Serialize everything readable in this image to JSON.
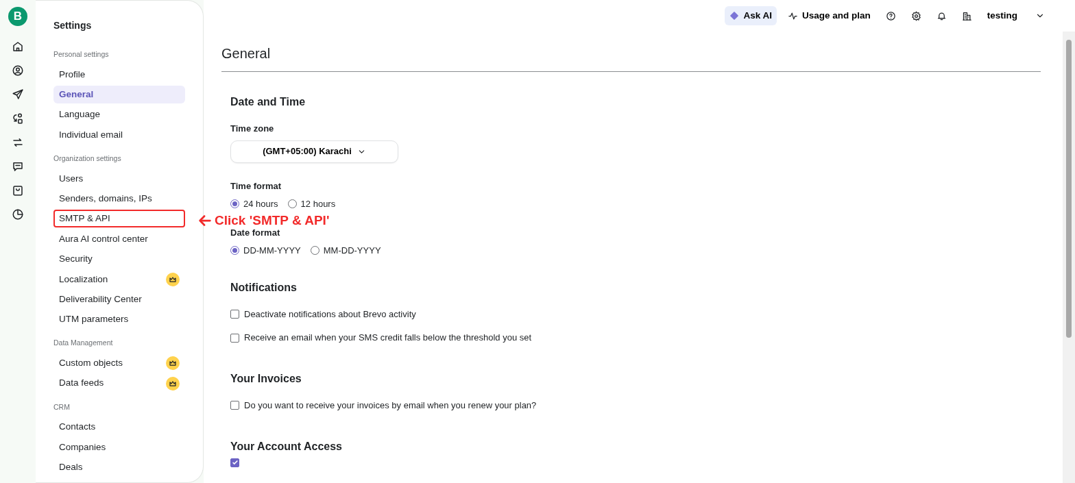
{
  "rail": {
    "logo": "B"
  },
  "sidebar": {
    "title": "Settings",
    "groups": [
      {
        "heading": "Personal settings",
        "items": [
          {
            "label": "Profile",
            "selected": false,
            "premium": false,
            "annotated": false
          },
          {
            "label": "General",
            "selected": true,
            "premium": false,
            "annotated": false
          },
          {
            "label": "Language",
            "selected": false,
            "premium": false,
            "annotated": false
          },
          {
            "label": "Individual email",
            "selected": false,
            "premium": false,
            "annotated": false
          }
        ]
      },
      {
        "heading": "Organization settings",
        "items": [
          {
            "label": "Users",
            "selected": false,
            "premium": false,
            "annotated": false
          },
          {
            "label": "Senders, domains, IPs",
            "selected": false,
            "premium": false,
            "annotated": false
          },
          {
            "label": "SMTP & API",
            "selected": false,
            "premium": false,
            "annotated": true
          },
          {
            "label": "Aura AI control center",
            "selected": false,
            "premium": false,
            "annotated": false
          },
          {
            "label": "Security",
            "selected": false,
            "premium": false,
            "annotated": false
          },
          {
            "label": "Localization",
            "selected": false,
            "premium": true,
            "annotated": false
          },
          {
            "label": "Deliverability Center",
            "selected": false,
            "premium": false,
            "annotated": false
          },
          {
            "label": "UTM parameters",
            "selected": false,
            "premium": false,
            "annotated": false
          }
        ]
      },
      {
        "heading": "Data Management",
        "items": [
          {
            "label": "Custom objects",
            "selected": false,
            "premium": true,
            "annotated": false
          },
          {
            "label": "Data feeds",
            "selected": false,
            "premium": true,
            "annotated": false
          }
        ]
      },
      {
        "heading": "CRM",
        "items": [
          {
            "label": "Contacts",
            "selected": false,
            "premium": false,
            "annotated": false
          },
          {
            "label": "Companies",
            "selected": false,
            "premium": false,
            "annotated": false
          },
          {
            "label": "Deals",
            "selected": false,
            "premium": false,
            "annotated": false
          }
        ]
      }
    ]
  },
  "annotation": {
    "text": "Click 'SMTP & API'"
  },
  "topbar": {
    "ask_ai": "Ask AI",
    "usage": "Usage and plan",
    "account": "testing"
  },
  "page_title": "General",
  "sections": [
    {
      "heading": "Date and Time",
      "fields": [
        {
          "kind": "select",
          "label": "Time zone",
          "value": "(GMT+05:00) Karachi"
        },
        {
          "kind": "radios",
          "label": "Time format",
          "options": [
            {
              "label": "24 hours",
              "selected": true
            },
            {
              "label": "12 hours",
              "selected": false
            }
          ]
        },
        {
          "kind": "radios",
          "label": "Date format",
          "options": [
            {
              "label": "DD-MM-YYYY",
              "selected": true
            },
            {
              "label": "MM-DD-YYYY",
              "selected": false
            }
          ]
        }
      ]
    },
    {
      "heading": "Notifications",
      "fields": [
        {
          "kind": "checkbox",
          "label": "Deactivate notifications about Brevo activity",
          "checked": false
        },
        {
          "kind": "checkbox",
          "label": "Receive an email when your SMS credit falls below the threshold you set",
          "checked": false
        }
      ]
    },
    {
      "heading": "Your Invoices",
      "fields": [
        {
          "kind": "checkbox",
          "label": "Do you want to receive your invoices by email when you renew your plan?",
          "checked": false
        }
      ]
    },
    {
      "heading": "Your Account Access",
      "fields": [
        {
          "kind": "checkbox",
          "checked": true
        }
      ]
    }
  ]
}
